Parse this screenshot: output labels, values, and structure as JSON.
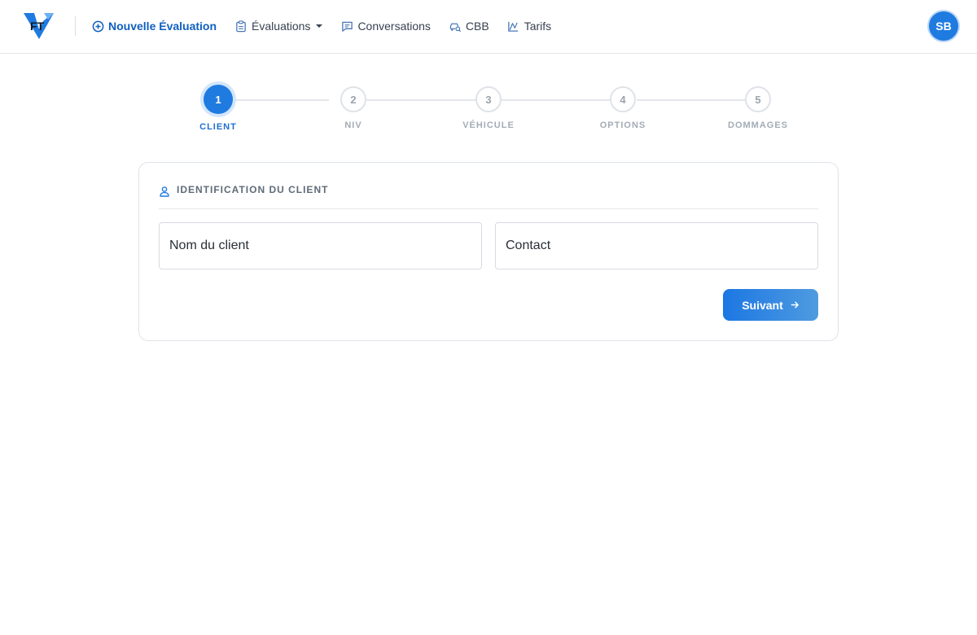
{
  "brand": {
    "logo_text": "FT"
  },
  "nav": {
    "items": [
      {
        "label": "Nouvelle Évaluation",
        "icon": "plus-circle-icon"
      },
      {
        "label": "Évaluations",
        "icon": "clipboard-icon"
      },
      {
        "label": "Conversations",
        "icon": "chat-icon"
      },
      {
        "label": "CBB",
        "icon": "car-search-icon"
      },
      {
        "label": "Tarifs",
        "icon": "chart-icon"
      }
    ]
  },
  "user": {
    "initials": "SB"
  },
  "stepper": {
    "active": 1,
    "steps": [
      {
        "number": "1",
        "label": "CLIENT"
      },
      {
        "number": "2",
        "label": "NIV"
      },
      {
        "number": "3",
        "label": "VÉHICULE"
      },
      {
        "number": "4",
        "label": "OPTIONS"
      },
      {
        "number": "5",
        "label": "DOMMAGES"
      }
    ]
  },
  "form": {
    "title": "IDENTIFICATION DU CLIENT",
    "client_name": {
      "placeholder": "Nom du client",
      "value": ""
    },
    "contact": {
      "placeholder": "Contact",
      "value": ""
    },
    "next_label": "Suivant"
  },
  "colors": {
    "accent": "#1f7be0",
    "accent_dark": "#0f5fbf"
  }
}
